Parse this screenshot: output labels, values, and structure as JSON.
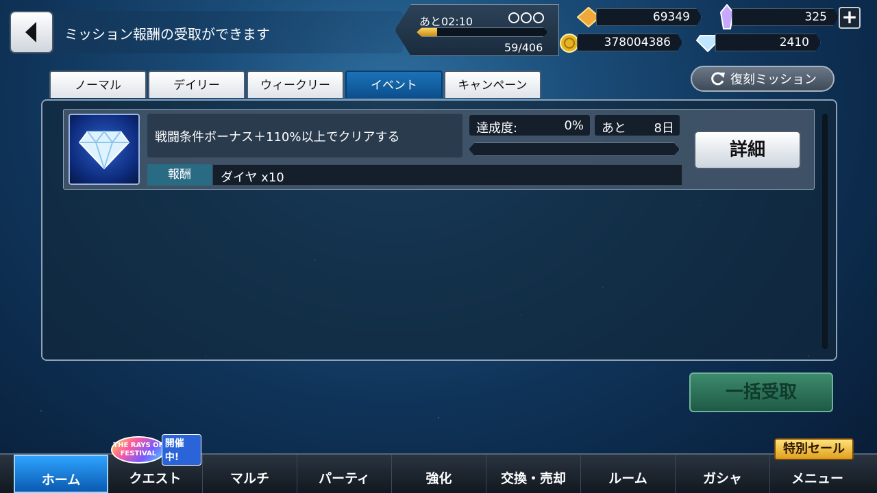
{
  "header": {
    "title": "ミッション報酬の受取ができます"
  },
  "status": {
    "stamina_timer": "あと02:10",
    "stamina_count": "59/406",
    "stamina_fill_fraction": 0.15,
    "topaz": "69349",
    "crystals": "325",
    "gold": "378004386",
    "diamonds": "2410"
  },
  "tabs": [
    {
      "label": "ノーマル"
    },
    {
      "label": "デイリー"
    },
    {
      "label": "ウィークリー"
    },
    {
      "label": "イベント"
    },
    {
      "label": "キャンペーン"
    }
  ],
  "active_tab": "イベント",
  "revival_button": "復刻ミッション",
  "mission": {
    "description": "戦闘条件ボーナス＋110%以上でクリアする",
    "reward_label": "報酬",
    "reward_value": "ダイヤ x10",
    "progress_label": "達成度:",
    "progress_value": "0%",
    "progress_fraction": 0,
    "remaining_label": "あと",
    "remaining_value": "8日",
    "detail_button": "詳細"
  },
  "claim_all_button": "一括受取",
  "event_badge": {
    "logo_text": "THE RAYS OF FESTIVAL",
    "label": "開催中!"
  },
  "sale_badge": "特別セール",
  "nav": [
    {
      "label": "ホーム"
    },
    {
      "label": "クエスト"
    },
    {
      "label": "マルチ"
    },
    {
      "label": "パーティ"
    },
    {
      "label": "強化"
    },
    {
      "label": "交換・売却"
    },
    {
      "label": "ルーム"
    },
    {
      "label": "ガシャ"
    },
    {
      "label": "メニュー"
    }
  ],
  "colors": {
    "active_tab": "#0d4e8c",
    "active_nav": "#2ea3ff",
    "claim_button": "#1e5a46"
  }
}
